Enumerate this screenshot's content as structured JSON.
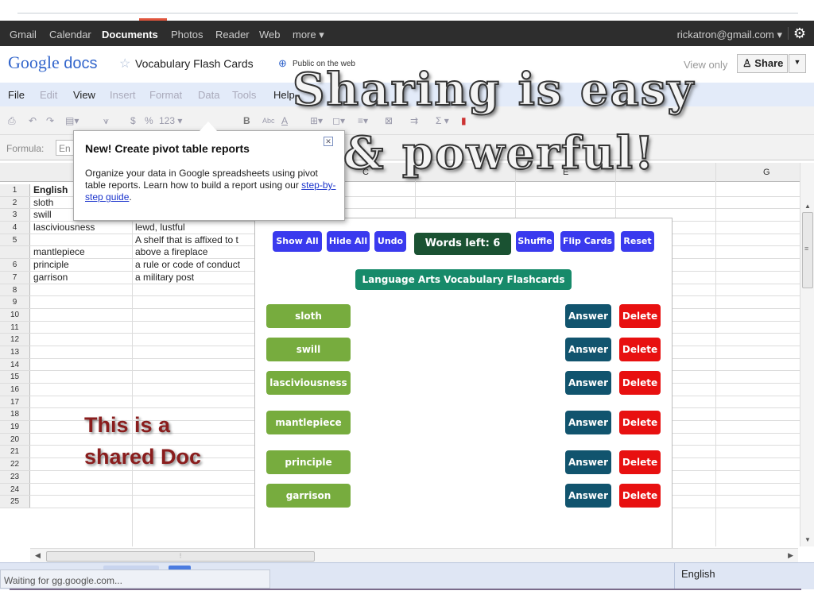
{
  "gbar": {
    "items": [
      "Gmail",
      "Calendar",
      "Documents",
      "Photos",
      "Reader",
      "Web",
      "more ▾"
    ],
    "active": "Documents",
    "account": "rickatron@gmail.com ▾"
  },
  "header": {
    "logo_google": "Google",
    "logo_docs": "docs",
    "doc_title": "Vocabulary Flash Cards",
    "visibility": "Public on the web",
    "view_only": "View only",
    "share_label": "Share"
  },
  "menu": {
    "items": [
      "File",
      "Edit",
      "View",
      "Insert",
      "Format",
      "Data",
      "Tools",
      "Help"
    ]
  },
  "toolbar": {
    "currency": "$",
    "percent": "%",
    "number": "123 ▾",
    "bold": "B",
    "strike": "Abc",
    "textcolor": "A",
    "sum": "Σ ▾"
  },
  "formula": {
    "label": "Formula:",
    "value": "En"
  },
  "columns": {
    "c": "C",
    "e": "E",
    "g": "G"
  },
  "rows": [
    {
      "num": "1",
      "a": "English",
      "b": ""
    },
    {
      "num": "2",
      "a": "sloth",
      "b": ""
    },
    {
      "num": "3",
      "a": "swill",
      "b": ""
    },
    {
      "num": "4",
      "a": "lasciviousness",
      "b": "lewd, lustful"
    },
    {
      "num": "5",
      "a": "",
      "b": "A shelf that is affixed to t"
    },
    {
      "num": "",
      "a": "mantlepiece",
      "b": "above a fireplace"
    },
    {
      "num": "6",
      "a": "principle",
      "b": "a rule or code of conduct"
    },
    {
      "num": "7",
      "a": "garrison",
      "b": "a military post"
    },
    {
      "num": "8",
      "a": "",
      "b": ""
    },
    {
      "num": "9",
      "a": "",
      "b": ""
    },
    {
      "num": "10",
      "a": "",
      "b": ""
    },
    {
      "num": "11",
      "a": "",
      "b": ""
    },
    {
      "num": "12",
      "a": "",
      "b": ""
    },
    {
      "num": "13",
      "a": "",
      "b": ""
    },
    {
      "num": "14",
      "a": "",
      "b": ""
    },
    {
      "num": "15",
      "a": "",
      "b": ""
    },
    {
      "num": "16",
      "a": "",
      "b": ""
    },
    {
      "num": "17",
      "a": "",
      "b": ""
    },
    {
      "num": "18",
      "a": "",
      "b": ""
    },
    {
      "num": "19",
      "a": "",
      "b": ""
    },
    {
      "num": "20",
      "a": "",
      "b": ""
    },
    {
      "num": "21",
      "a": "",
      "b": ""
    },
    {
      "num": "22",
      "a": "",
      "b": ""
    },
    {
      "num": "23",
      "a": "",
      "b": ""
    },
    {
      "num": "24",
      "a": "",
      "b": ""
    },
    {
      "num": "25",
      "a": "",
      "b": ""
    }
  ],
  "popup": {
    "title": "New! Create pivot table reports",
    "body": "Organize your data in Google spreadsheets using pivot table reports. Learn how to build a report using our",
    "link": "step-by-step guide",
    "end": ".",
    "close": "✕"
  },
  "flashcards": {
    "show_all": "Show All",
    "hide_all": "Hide All",
    "undo": "Undo",
    "words_left": "Words left: 6",
    "shuffle": "Shuffle",
    "flip_cards": "Flip Cards",
    "reset": "Reset",
    "deck_title": "Language Arts Vocabulary Flashcards",
    "answer_label": "Answer",
    "delete_label": "Delete",
    "words": [
      "sloth",
      "swill",
      "lasciviousness",
      "mantlepiece",
      "principle",
      "garrison"
    ]
  },
  "overlay": {
    "line1": "Sharing  is easy",
    "line2": "& powerful!",
    "note1": "This is a",
    "note2": "shared Doc"
  },
  "status": {
    "loading": "Waiting for gg.google.com...",
    "sheet": "English"
  },
  "colors": {
    "blue_btn": "#3a3aee",
    "word_btn": "#77ac3e",
    "answer_btn": "#11546e",
    "delete_btn": "#e81010",
    "count_bg": "#1a5232",
    "deck_bg": "#178a6a"
  }
}
